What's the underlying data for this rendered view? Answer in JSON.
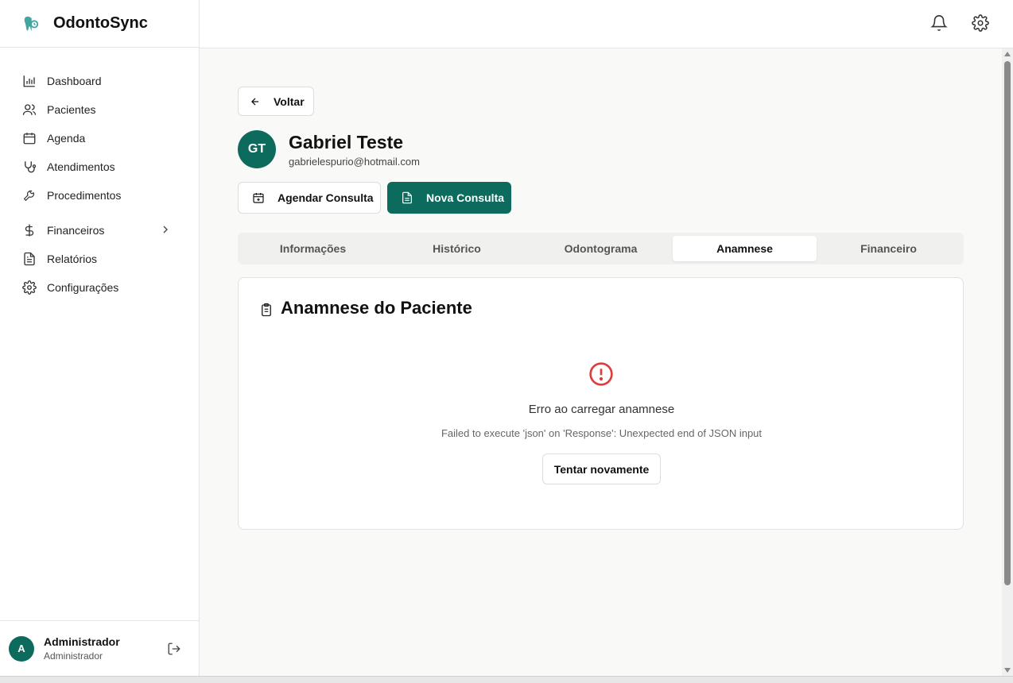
{
  "brand": {
    "name": "OdontoSync",
    "icon": "tooth-icon"
  },
  "sidebar": {
    "items": [
      {
        "label": "Dashboard",
        "icon": "bar-chart-icon"
      },
      {
        "label": "Pacientes",
        "icon": "users-icon"
      },
      {
        "label": "Agenda",
        "icon": "calendar-icon"
      },
      {
        "label": "Atendimentos",
        "icon": "stethoscope-icon"
      },
      {
        "label": "Procedimentos",
        "icon": "wrench-icon"
      },
      {
        "label": "Financeiros",
        "icon": "dollar-icon",
        "has_submenu": true
      },
      {
        "label": "Relatórios",
        "icon": "file-text-icon"
      },
      {
        "label": "Configurações",
        "icon": "gear-icon"
      }
    ]
  },
  "user": {
    "initial": "A",
    "name": "Administrador",
    "role": "Administrador"
  },
  "back": {
    "label": "Voltar"
  },
  "patient": {
    "initials": "GT",
    "name": "Gabriel Teste",
    "email": "gabrielespurio@hotmail.com"
  },
  "actions": {
    "schedule": "Agendar Consulta",
    "new": "Nova Consulta"
  },
  "tabs": [
    {
      "label": "Informações",
      "active": false
    },
    {
      "label": "Histórico",
      "active": false
    },
    {
      "label": "Odontograma",
      "active": false
    },
    {
      "label": "Anamnese",
      "active": true
    },
    {
      "label": "Financeiro",
      "active": false
    }
  ],
  "card": {
    "title": "Anamnese do Paciente",
    "error_title": "Erro ao carregar anamnese",
    "error_message": "Failed to execute 'json' on 'Response': Unexpected end of JSON input",
    "retry": "Tentar novamente"
  },
  "colors": {
    "primary": "#0d6b5e",
    "error": "#e03c3c",
    "brand_icon": "#3fa7a0"
  }
}
